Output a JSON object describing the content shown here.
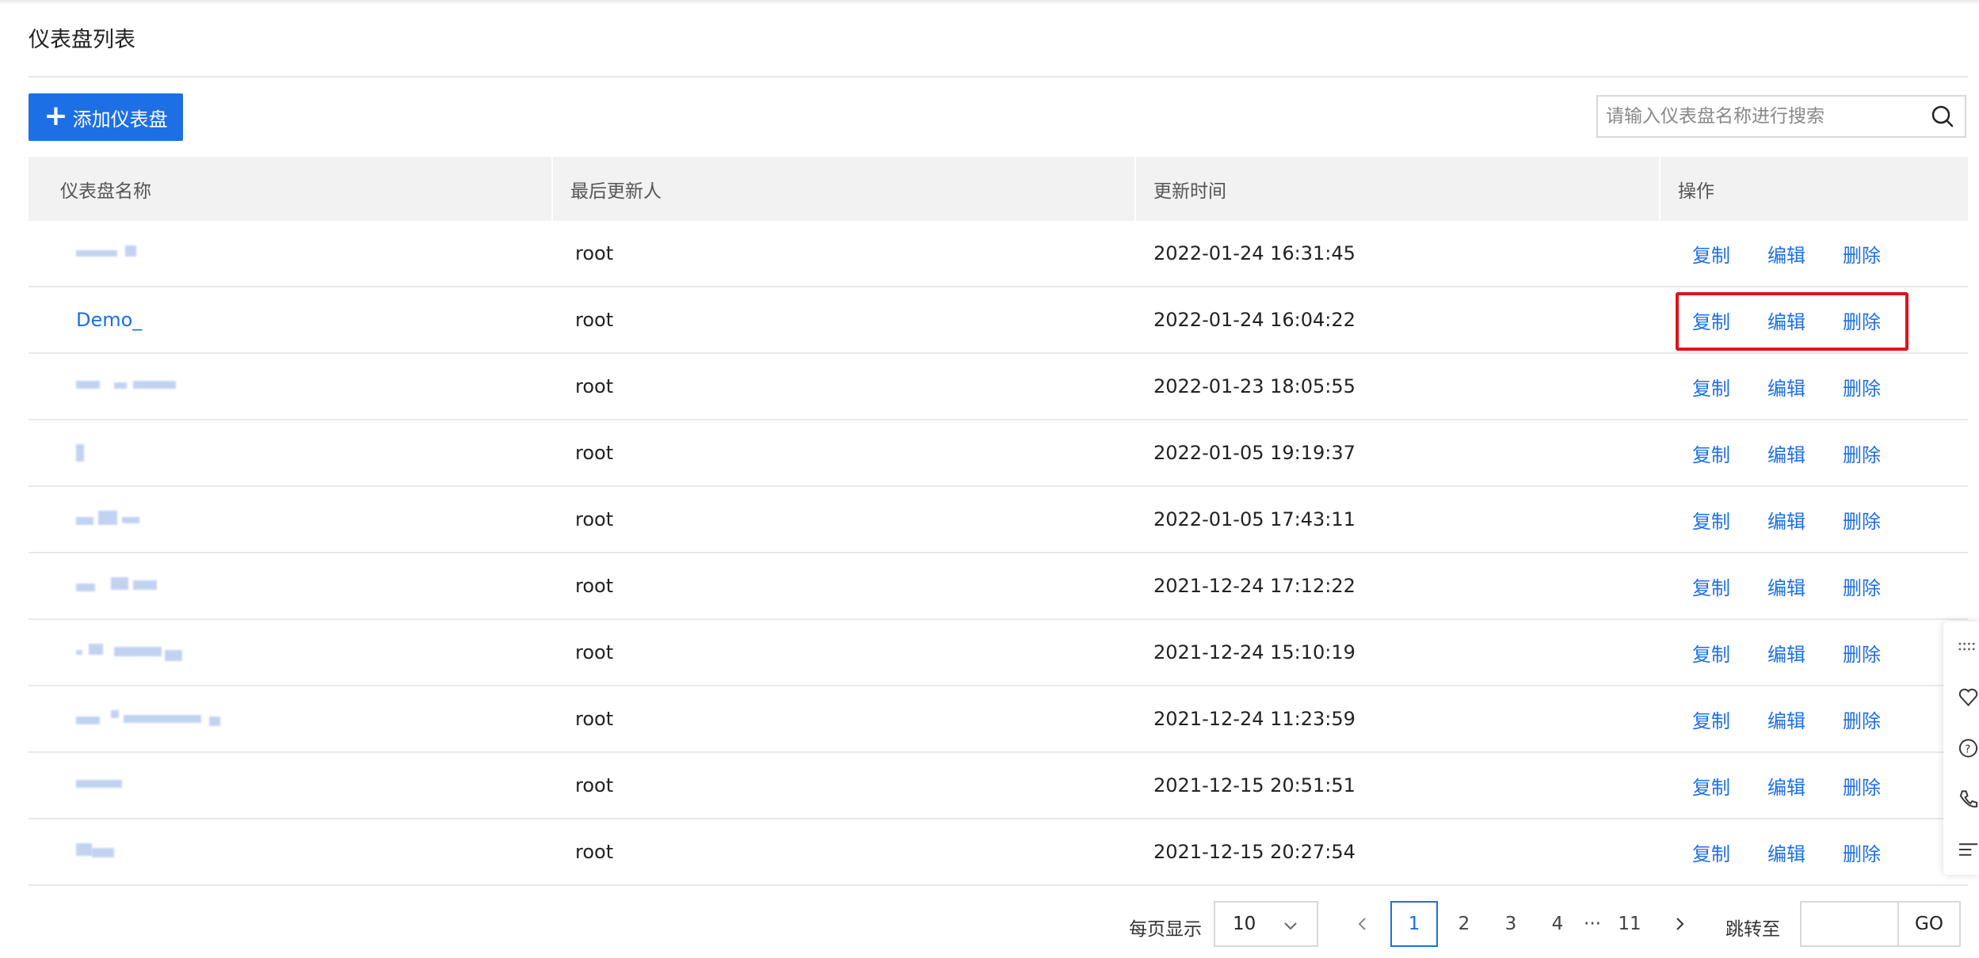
{
  "page": {
    "title": "仪表盘列表"
  },
  "toolbar": {
    "add_label": "添加仪表盘",
    "add_icon": "plus-icon"
  },
  "search": {
    "placeholder": "请输入仪表盘名称进行搜索",
    "icon": "search-icon"
  },
  "table": {
    "headers": [
      "仪表盘名称",
      "最后更新人",
      "更新时间",
      "操作"
    ],
    "actions": [
      "复制",
      "编辑",
      "删除"
    ],
    "rows": [
      {
        "name": "",
        "updater": "root",
        "time": "2022-01-24 16:31:45"
      },
      {
        "name": "Demo_",
        "updater": "root",
        "time": "2022-01-24 16:04:22"
      },
      {
        "name": "",
        "updater": "root",
        "time": "2022-01-23 18:05:55"
      },
      {
        "name": "",
        "updater": "root",
        "time": "2022-01-05 19:19:37"
      },
      {
        "name": "",
        "updater": "root",
        "time": "2022-01-05 17:43:11"
      },
      {
        "name": "",
        "updater": "root",
        "time": "2021-12-24 17:12:22"
      },
      {
        "name": "",
        "updater": "root",
        "time": "2021-12-24 15:10:19"
      },
      {
        "name": "",
        "updater": "root",
        "time": "2021-12-24 11:23:59"
      },
      {
        "name": "",
        "updater": "root",
        "time": "2021-12-15 20:51:51"
      },
      {
        "name": "",
        "updater": "root",
        "time": "2021-12-15 20:27:54"
      }
    ]
  },
  "pagination": {
    "per_page_label": "每页显示",
    "per_page_value": "10",
    "pages": [
      "1",
      "2",
      "3",
      "4"
    ],
    "ellipsis": "···",
    "last_page": "11",
    "current_page": "1",
    "jump_label": "跳转至",
    "go_label": "GO"
  },
  "colors": {
    "accent": "#1d6fe6",
    "highlight": "#e0141b",
    "header_bg": "#f2f2f2"
  }
}
